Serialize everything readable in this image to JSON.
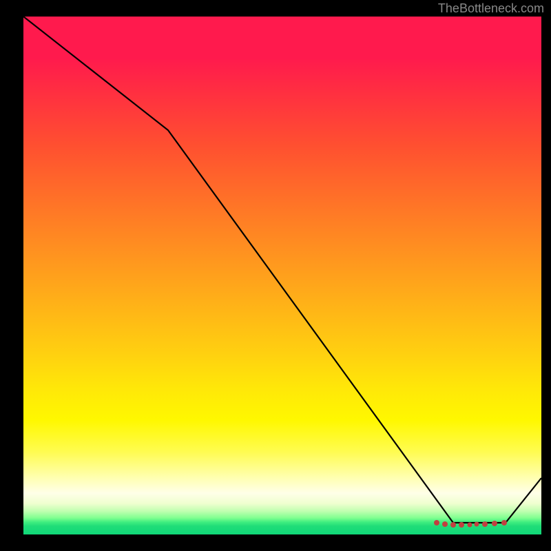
{
  "attribution": "TheBottleneck.com",
  "chart_data": {
    "type": "line",
    "title": "",
    "xlabel": "",
    "ylabel": "",
    "xlim": [
      0,
      100
    ],
    "ylim": [
      0,
      100
    ],
    "x": [
      0,
      28,
      83,
      93,
      100
    ],
    "values": [
      100,
      78,
      2,
      2,
      11
    ],
    "highlight_region": {
      "x_start": 80,
      "x_end": 94,
      "style": "dotted-red"
    },
    "background_gradient": {
      "direction": "vertical",
      "stops": [
        {
          "pos": 0,
          "color": "#ff1a4d"
        },
        {
          "pos": 50,
          "color": "#ffb018"
        },
        {
          "pos": 80,
          "color": "#fff800"
        },
        {
          "pos": 100,
          "color": "#10d878"
        }
      ]
    }
  }
}
